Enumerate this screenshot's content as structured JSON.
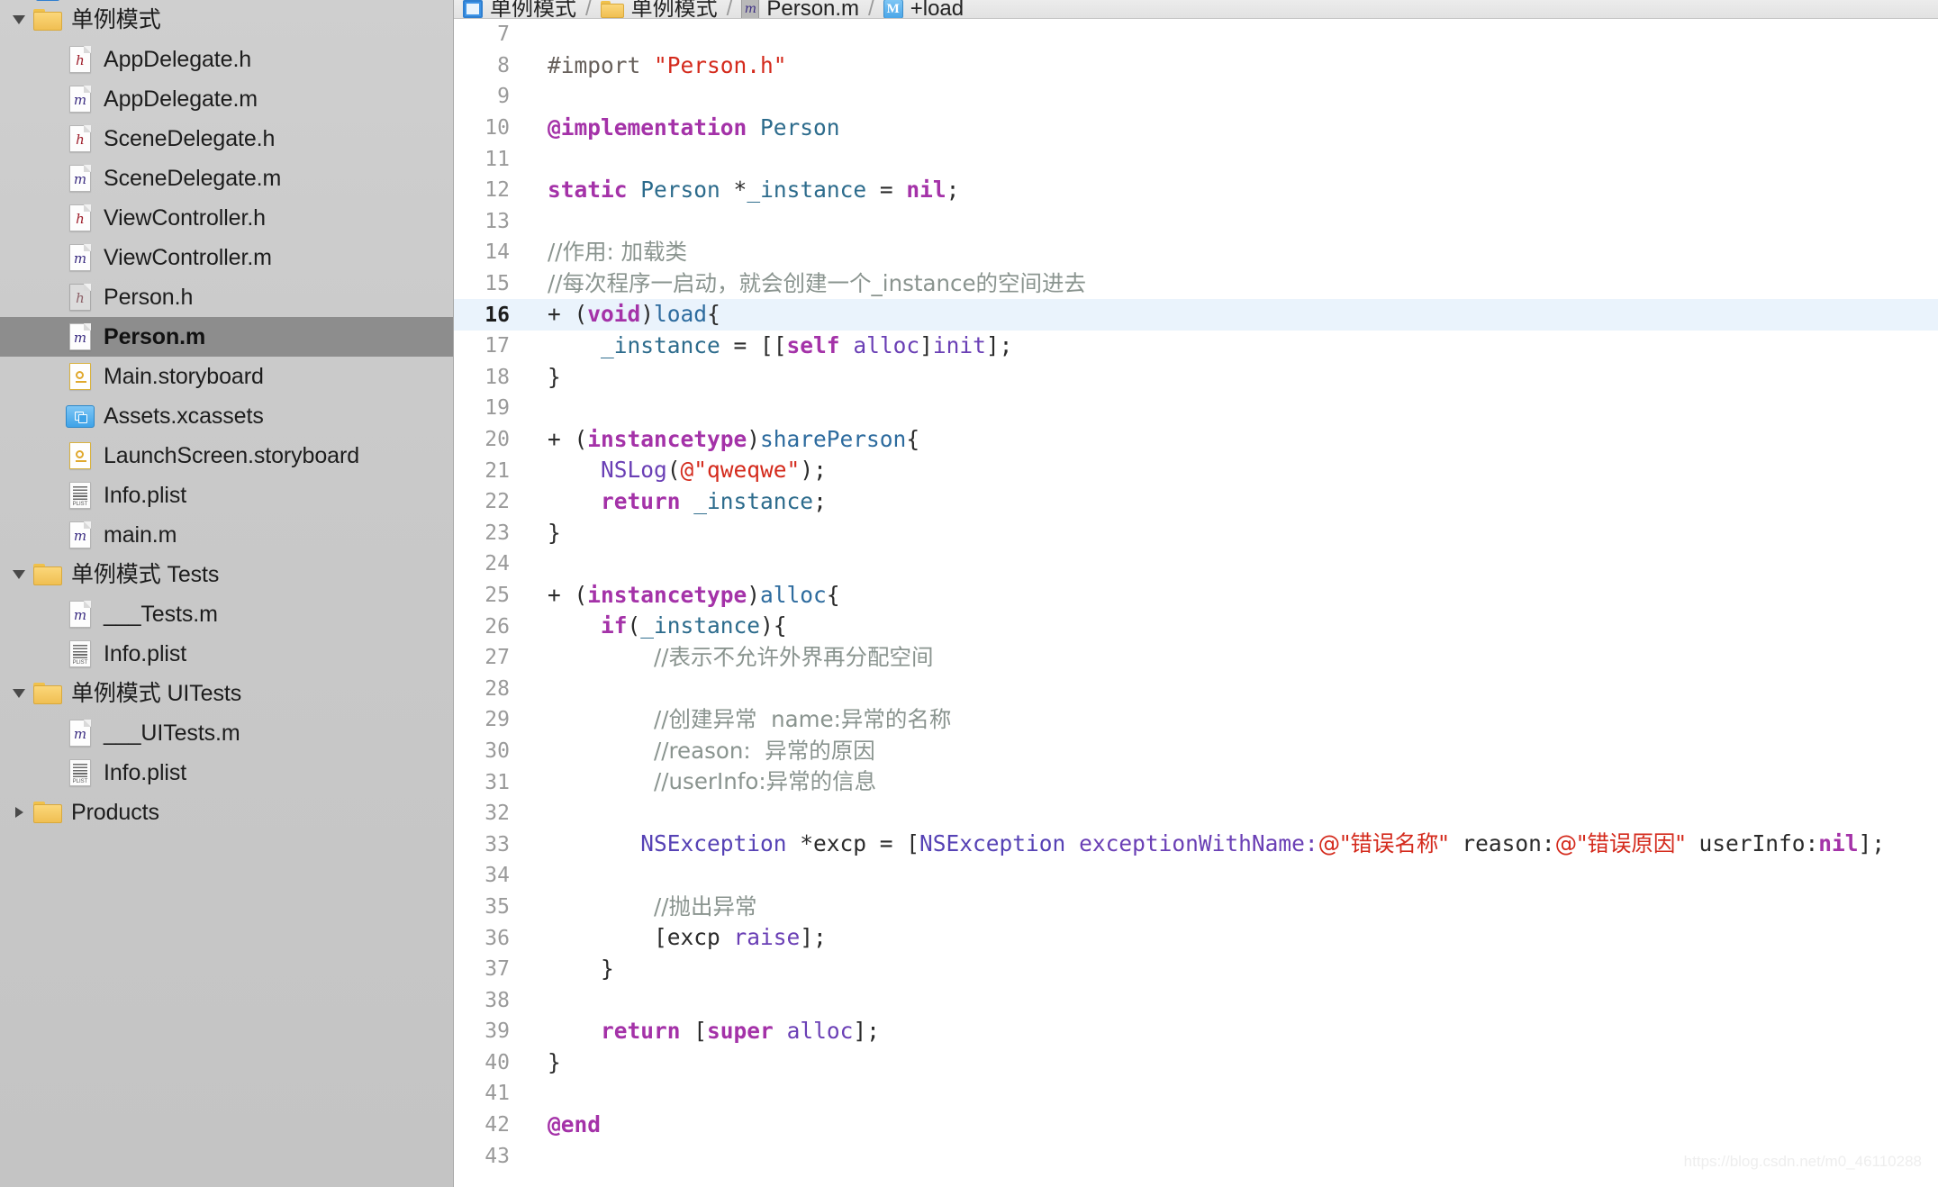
{
  "app": "Xcode",
  "navigator": {
    "partial_top_row": {
      "label": "单例模式",
      "icon": "project-icon"
    },
    "items": [
      {
        "label": "单例模式",
        "icon": "folder-icon",
        "indent": 0,
        "disclosure": "open",
        "selected": false
      },
      {
        "label": "AppDelegate.h",
        "icon": "header-file-icon",
        "indent": 1,
        "disclosure": "none",
        "selected": false
      },
      {
        "label": "AppDelegate.m",
        "icon": "objc-file-icon",
        "indent": 1,
        "disclosure": "none",
        "selected": false
      },
      {
        "label": "SceneDelegate.h",
        "icon": "header-file-icon",
        "indent": 1,
        "disclosure": "none",
        "selected": false
      },
      {
        "label": "SceneDelegate.m",
        "icon": "objc-file-icon",
        "indent": 1,
        "disclosure": "none",
        "selected": false
      },
      {
        "label": "ViewController.h",
        "icon": "header-file-icon",
        "indent": 1,
        "disclosure": "none",
        "selected": false
      },
      {
        "label": "ViewController.m",
        "icon": "objc-file-icon",
        "indent": 1,
        "disclosure": "none",
        "selected": false
      },
      {
        "label": "Person.h",
        "icon": "header-file-icon-dim",
        "indent": 1,
        "disclosure": "none",
        "selected": false
      },
      {
        "label": "Person.m",
        "icon": "objc-file-icon",
        "indent": 1,
        "disclosure": "none",
        "selected": true
      },
      {
        "label": "Main.storyboard",
        "icon": "storyboard-icon",
        "indent": 1,
        "disclosure": "none",
        "selected": false
      },
      {
        "label": "Assets.xcassets",
        "icon": "xcassets-icon",
        "indent": 1,
        "disclosure": "none",
        "selected": false
      },
      {
        "label": "LaunchScreen.storyboard",
        "icon": "storyboard-icon",
        "indent": 1,
        "disclosure": "none",
        "selected": false
      },
      {
        "label": "Info.plist",
        "icon": "plist-icon",
        "indent": 1,
        "disclosure": "none",
        "selected": false
      },
      {
        "label": "main.m",
        "icon": "objc-file-icon",
        "indent": 1,
        "disclosure": "none",
        "selected": false
      },
      {
        "label": "单例模式 Tests",
        "icon": "folder-icon",
        "indent": 0,
        "disclosure": "open",
        "selected": false
      },
      {
        "label": "___Tests.m",
        "icon": "objc-file-icon",
        "indent": 1,
        "disclosure": "none",
        "selected": false
      },
      {
        "label": "Info.plist",
        "icon": "plist-icon",
        "indent": 1,
        "disclosure": "none",
        "selected": false
      },
      {
        "label": "单例模式 UITests",
        "icon": "folder-icon",
        "indent": 0,
        "disclosure": "open",
        "selected": false
      },
      {
        "label": "___UITests.m",
        "icon": "objc-file-icon",
        "indent": 1,
        "disclosure": "none",
        "selected": false
      },
      {
        "label": "Info.plist",
        "icon": "plist-icon",
        "indent": 1,
        "disclosure": "none",
        "selected": false
      },
      {
        "label": "Products",
        "icon": "folder-icon",
        "indent": 0,
        "disclosure": "closed",
        "selected": false
      }
    ]
  },
  "jumpbar": {
    "crumbs": [
      {
        "label": "单例模式",
        "icon": "project-icon"
      },
      {
        "label": "单例模式",
        "icon": "folder-icon"
      },
      {
        "label": "Person.m",
        "icon": "objc-file-icon"
      },
      {
        "label": "+load",
        "icon": "method-icon"
      }
    ],
    "separator": "/"
  },
  "editor": {
    "file": "Person.m",
    "highlighted_line": 16,
    "first_visible_line": 7,
    "last_visible_line": 43,
    "lines": [
      {
        "n": 7,
        "tokens": []
      },
      {
        "n": 8,
        "tokens": [
          {
            "t": "#import ",
            "c": "t-pre"
          },
          {
            "t": "\"Person.h\"",
            "c": "t-str"
          }
        ]
      },
      {
        "n": 9,
        "tokens": []
      },
      {
        "n": 10,
        "tokens": [
          {
            "t": "@implementation",
            "c": "t-keyword"
          },
          {
            "t": " ",
            "c": "t-plain"
          },
          {
            "t": "Person",
            "c": "t-type"
          }
        ]
      },
      {
        "n": 11,
        "tokens": []
      },
      {
        "n": 12,
        "tokens": [
          {
            "t": "static",
            "c": "t-keyword"
          },
          {
            "t": " ",
            "c": "t-plain"
          },
          {
            "t": "Person",
            "c": "t-type"
          },
          {
            "t": " *",
            "c": "t-plain"
          },
          {
            "t": "_instance",
            "c": "t-var"
          },
          {
            "t": " = ",
            "c": "t-plain"
          },
          {
            "t": "nil",
            "c": "t-keyword"
          },
          {
            "t": ";",
            "c": "t-plain"
          }
        ]
      },
      {
        "n": 13,
        "tokens": []
      },
      {
        "n": 14,
        "tokens": [
          {
            "t": "//作用: 加载类",
            "c": "t-comment"
          }
        ]
      },
      {
        "n": 15,
        "tokens": [
          {
            "t": "//每次程序一启动，就会创建一个_instance的空间进去",
            "c": "t-comment"
          }
        ]
      },
      {
        "n": 16,
        "tokens": [
          {
            "t": "+ (",
            "c": "t-plain"
          },
          {
            "t": "void",
            "c": "t-keyword"
          },
          {
            "t": ")",
            "c": "t-plain"
          },
          {
            "t": "load",
            "c": "t-func"
          },
          {
            "t": "{",
            "c": "t-plain"
          }
        ]
      },
      {
        "n": 17,
        "tokens": [
          {
            "t": "    ",
            "c": "t-plain"
          },
          {
            "t": "_instance",
            "c": "t-var"
          },
          {
            "t": " = [[",
            "c": "t-plain"
          },
          {
            "t": "self",
            "c": "t-keyword"
          },
          {
            "t": " ",
            "c": "t-plain"
          },
          {
            "t": "alloc",
            "c": "t-msg"
          },
          {
            "t": "]",
            "c": "t-plain"
          },
          {
            "t": "init",
            "c": "t-msg"
          },
          {
            "t": "];",
            "c": "t-plain"
          }
        ]
      },
      {
        "n": 18,
        "tokens": [
          {
            "t": "}",
            "c": "t-plain"
          }
        ]
      },
      {
        "n": 19,
        "tokens": []
      },
      {
        "n": 20,
        "tokens": [
          {
            "t": "+ (",
            "c": "t-plain"
          },
          {
            "t": "instancetype",
            "c": "t-keyword"
          },
          {
            "t": ")",
            "c": "t-plain"
          },
          {
            "t": "sharePerson",
            "c": "t-func"
          },
          {
            "t": "{",
            "c": "t-plain"
          }
        ]
      },
      {
        "n": 21,
        "tokens": [
          {
            "t": "    ",
            "c": "t-plain"
          },
          {
            "t": "NSLog",
            "c": "t-msg"
          },
          {
            "t": "(",
            "c": "t-plain"
          },
          {
            "t": "@\"qweqwe\"",
            "c": "t-str"
          },
          {
            "t": ");",
            "c": "t-plain"
          }
        ]
      },
      {
        "n": 22,
        "tokens": [
          {
            "t": "    ",
            "c": "t-plain"
          },
          {
            "t": "return",
            "c": "t-keyword"
          },
          {
            "t": " ",
            "c": "t-plain"
          },
          {
            "t": "_instance",
            "c": "t-var"
          },
          {
            "t": ";",
            "c": "t-plain"
          }
        ]
      },
      {
        "n": 23,
        "tokens": [
          {
            "t": "}",
            "c": "t-plain"
          }
        ]
      },
      {
        "n": 24,
        "tokens": []
      },
      {
        "n": 25,
        "tokens": [
          {
            "t": "+ (",
            "c": "t-plain"
          },
          {
            "t": "instancetype",
            "c": "t-keyword"
          },
          {
            "t": ")",
            "c": "t-plain"
          },
          {
            "t": "alloc",
            "c": "t-func"
          },
          {
            "t": "{",
            "c": "t-plain"
          }
        ]
      },
      {
        "n": 26,
        "tokens": [
          {
            "t": "    ",
            "c": "t-plain"
          },
          {
            "t": "if",
            "c": "t-keyword"
          },
          {
            "t": "(",
            "c": "t-plain"
          },
          {
            "t": "_instance",
            "c": "t-var"
          },
          {
            "t": "){",
            "c": "t-plain"
          }
        ]
      },
      {
        "n": 27,
        "tokens": [
          {
            "t": "        ",
            "c": "t-plain"
          },
          {
            "t": "//表示不允许外界再分配空间",
            "c": "t-comment"
          }
        ]
      },
      {
        "n": 28,
        "tokens": []
      },
      {
        "n": 29,
        "tokens": [
          {
            "t": "        ",
            "c": "t-plain"
          },
          {
            "t": "//创建异常  name:异常的名称",
            "c": "t-comment"
          }
        ]
      },
      {
        "n": 30,
        "tokens": [
          {
            "t": "        ",
            "c": "t-plain"
          },
          {
            "t": "//reason:  异常的原因",
            "c": "t-comment"
          }
        ]
      },
      {
        "n": 31,
        "tokens": [
          {
            "t": "        ",
            "c": "t-plain"
          },
          {
            "t": "//userInfo:异常的信息",
            "c": "t-comment"
          }
        ]
      },
      {
        "n": 32,
        "tokens": []
      },
      {
        "n": 33,
        "tokens": [
          {
            "t": "       ",
            "c": "t-plain"
          },
          {
            "t": "NSException",
            "c": "t-classp"
          },
          {
            "t": " *excp = [",
            "c": "t-plain"
          },
          {
            "t": "NSException",
            "c": "t-classp"
          },
          {
            "t": " ",
            "c": "t-plain"
          },
          {
            "t": "exceptionWithName:",
            "c": "t-msg"
          },
          {
            "t": "@\"错误名称\"",
            "c": "t-str"
          },
          {
            "t": " reason:",
            "c": "t-plain"
          },
          {
            "t": "@\"错误原因\"",
            "c": "t-str"
          },
          {
            "t": " userInfo:",
            "c": "t-plain"
          },
          {
            "t": "nil",
            "c": "t-keyword"
          },
          {
            "t": "];",
            "c": "t-plain"
          }
        ]
      },
      {
        "n": 34,
        "tokens": []
      },
      {
        "n": 35,
        "tokens": [
          {
            "t": "        ",
            "c": "t-plain"
          },
          {
            "t": "//抛出异常",
            "c": "t-comment"
          }
        ]
      },
      {
        "n": 36,
        "tokens": [
          {
            "t": "        [excp ",
            "c": "t-plain"
          },
          {
            "t": "raise",
            "c": "t-msg"
          },
          {
            "t": "];",
            "c": "t-plain"
          }
        ]
      },
      {
        "n": 37,
        "tokens": [
          {
            "t": "    }",
            "c": "t-plain"
          }
        ]
      },
      {
        "n": 38,
        "tokens": []
      },
      {
        "n": 39,
        "tokens": [
          {
            "t": "    ",
            "c": "t-plain"
          },
          {
            "t": "return",
            "c": "t-keyword"
          },
          {
            "t": " [",
            "c": "t-plain"
          },
          {
            "t": "super",
            "c": "t-keyword"
          },
          {
            "t": " ",
            "c": "t-plain"
          },
          {
            "t": "alloc",
            "c": "t-msg"
          },
          {
            "t": "];",
            "c": "t-plain"
          }
        ]
      },
      {
        "n": 40,
        "tokens": [
          {
            "t": "}",
            "c": "t-plain"
          }
        ]
      },
      {
        "n": 41,
        "tokens": []
      },
      {
        "n": 42,
        "tokens": [
          {
            "t": "@end",
            "c": "t-keyword"
          }
        ]
      },
      {
        "n": 43,
        "tokens": []
      }
    ]
  },
  "watermark": "https://blog.csdn.net/m0_46110288",
  "colors": {
    "sidebar_bg": "#c9c9c9",
    "selection_bg": "#8d8d8d",
    "highlight_line_bg": "#eaf3fc",
    "editor_bg": "#ffffff",
    "string": "#d42a1c",
    "keyword": "#a432a8",
    "comment": "#8a948f",
    "type": "#2c6b8c",
    "message": "#6a3fb5",
    "class": "#5642b5",
    "function": "#2d6b9e"
  }
}
